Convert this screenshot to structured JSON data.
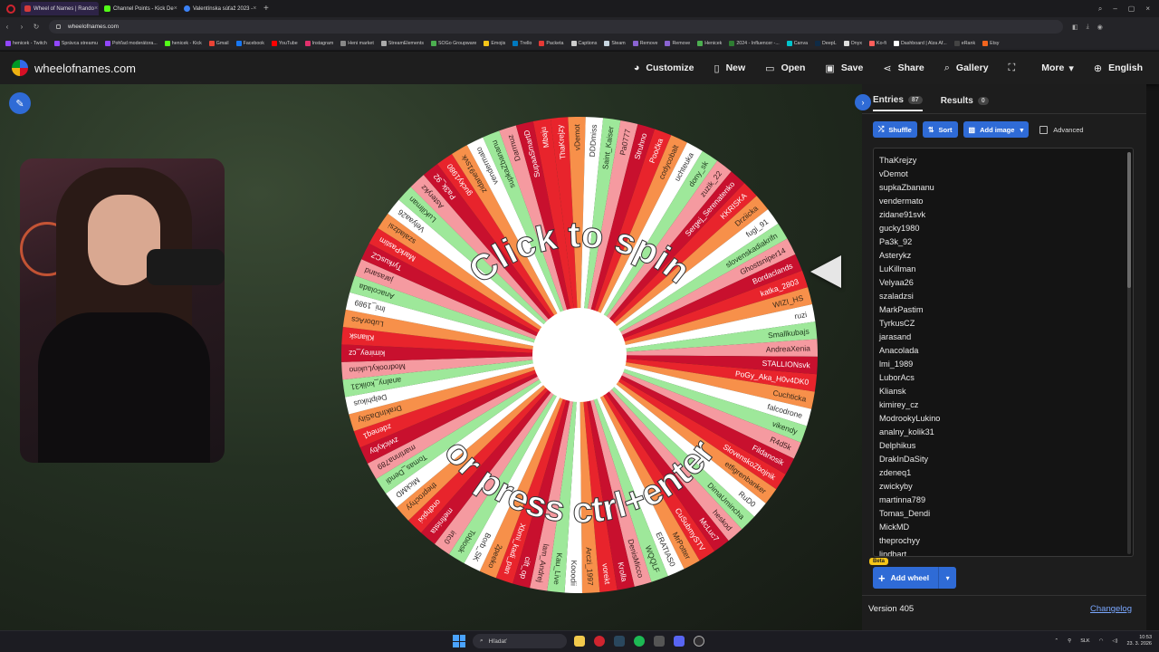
{
  "browser": {
    "tabs": [
      {
        "title": "Wheel of Names | Rando",
        "color": "#d43b3b",
        "active": true
      },
      {
        "title": "Channel Points - Kick De",
        "color": "#53fc18",
        "active": false
      },
      {
        "title": "Valentínska súťaž 2023 - ",
        "color": "#3b82f6",
        "active": false
      }
    ],
    "url": "wheelofnames.com",
    "bookmarks": [
      {
        "label": "henicek - Twitch",
        "color": "#9146ff"
      },
      {
        "label": "Správca streamu",
        "color": "#9146ff"
      },
      {
        "label": "Pohľad moderátora...",
        "color": "#9146ff"
      },
      {
        "label": "henicek - Kick",
        "color": "#53fc18"
      },
      {
        "label": "Gmail",
        "color": "#ea4335"
      },
      {
        "label": "Facebook",
        "color": "#1877f2"
      },
      {
        "label": "YouTube",
        "color": "#ff0000"
      },
      {
        "label": "Instagram",
        "color": "#e1306c"
      },
      {
        "label": "Heni market",
        "color": "#888888"
      },
      {
        "label": "StreamElements",
        "color": "#aaaaaa"
      },
      {
        "label": "SOGo Groupware",
        "color": "#4caf50"
      },
      {
        "label": "Emojis",
        "color": "#f5c518"
      },
      {
        "label": "Trello",
        "color": "#0079bf"
      },
      {
        "label": "Packeta",
        "color": "#e53935"
      },
      {
        "label": "Captions",
        "color": "#cccccc"
      },
      {
        "label": "Steam",
        "color": "#c7d5e0"
      },
      {
        "label": "Remove",
        "color": "#8a63d2"
      },
      {
        "label": "Remove",
        "color": "#8a63d2"
      },
      {
        "label": "Henicek",
        "color": "#4caf50"
      },
      {
        "label": "2024 - Influencer -...",
        "color": "#2e7d32"
      },
      {
        "label": "Canva",
        "color": "#00c4cc"
      },
      {
        "label": "DeepL",
        "color": "#0f2b46"
      },
      {
        "label": "Onyx",
        "color": "#dddddd"
      },
      {
        "label": "Ko-fi",
        "color": "#ff5e5b"
      },
      {
        "label": "Dashboard | Alza Af...",
        "color": "#ffffff"
      },
      {
        "label": "eRank",
        "color": "#444444"
      },
      {
        "label": "Etsy",
        "color": "#f1641e"
      }
    ]
  },
  "site": {
    "name": "wheelofnames.com",
    "menu": [
      {
        "label": "Customize",
        "icon": "palette-icon",
        "glyph": "◕"
      },
      {
        "label": "New",
        "icon": "new-file-icon",
        "glyph": "▯"
      },
      {
        "label": "Open",
        "icon": "folder-icon",
        "glyph": "▭"
      },
      {
        "label": "Save",
        "icon": "save-icon",
        "glyph": "▣"
      },
      {
        "label": "Share",
        "icon": "share-icon",
        "glyph": "⋖"
      },
      {
        "label": "Gallery",
        "icon": "search-icon",
        "glyph": "⌕"
      },
      {
        "label": "",
        "icon": "fullscreen-icon",
        "glyph": "⛶"
      },
      {
        "label": "More",
        "icon": "chevron-down-icon",
        "glyph": "▾"
      },
      {
        "label": "English",
        "icon": "globe-icon",
        "glyph": "⊕"
      }
    ]
  },
  "wheel": {
    "overlay_top": "Click to spin",
    "overlay_bottom": "or press ctrl+enter",
    "segment_colors": [
      "#e8242c",
      "#f7904a",
      "#ffffff",
      "#9ee89a",
      "#f59aa0",
      "#c8102e"
    ],
    "names": [
      "ThaKrejzy",
      "vDemot",
      "DDDmiss",
      "Saint_Kaiser",
      "Pa0777",
      "Struhno",
      "Poočka",
      "codycobalt",
      "uchteuka",
      "dony_sk",
      "zuzik_22",
      "Sergej_Serenatenko",
      "KKRISKA",
      "Drziicka",
      "fugi_91",
      "slovenskadiakrifn",
      "Ghostsniper14",
      "Bordaclands",
      "katka_2803",
      "WIZI_HS",
      "ruzi",
      "Smallkubajs",
      "AndreaXenia",
      "STALLIONsvk",
      "PoGy_Aka_H0v4DK0",
      "Cuchticka",
      "falcodrone",
      "vikendy",
      "R4d5k",
      "Fildanosik",
      "SlovenskoZbojnik",
      "etfigrenbanker",
      "RuD0",
      "DimaUmincha",
      "heskod",
      "McLuc7",
      "CuSubmySTV",
      "MrPotter",
      "ERATIAS0",
      "WQQLF",
      "DenisMicco",
      "Krolla",
      "vorekt",
      "Arczi_1997",
      "Kooodii",
      "Kau_Live",
      "lam_Andrej",
      "cift_op",
      "Xbmi_kadi_pan",
      "2peeko",
      "Borb_SK",
      "Tobiosk",
      "irtc0",
      "mefinista",
      "ondhpixi",
      "theprochyy",
      "MickMD",
      "Tomas_Dendi",
      "martinna789",
      "zwickyby",
      "zdeneq1",
      "DrakInDaSity",
      "Delphikus",
      "analny_kolik31",
      "ModrookyLukino",
      "kimirey_cz",
      "Kliansk",
      "LuborAcs",
      "lmi_1989",
      "Anacolada",
      "jarasand",
      "TyrkusCZ",
      "MarkPastim",
      "szaladzsi",
      "Velyaa26",
      "LuKillman",
      "Asterykz",
      "Pa3k_92",
      "gucky1980",
      "zidane91svk",
      "vendermato",
      "supkaZbananu",
      "Darrnuz",
      "SupaaSmartD",
      "Mbaju"
    ]
  },
  "sidebar": {
    "entries_tab": "Entries",
    "entries_count": "87",
    "results_tab": "Results",
    "results_count": "0",
    "shuffle": "Shuffle",
    "sort": "Sort",
    "add_image": "Add image",
    "advanced": "Advanced",
    "entries": [
      "ThaKrejzy",
      "vDemot",
      "supkaZbananu",
      "vendermato",
      "zidane91svk",
      "gucky1980",
      "Pa3k_92",
      "Asterykz",
      "LuKillman",
      "Velyaa26",
      "szaladzsi",
      "MarkPastim",
      "TyrkusCZ",
      "jarasand",
      "Anacolada",
      "lmi_1989",
      "LuborAcs",
      "Kliansk",
      "kimirey_cz",
      "ModrookyLukino",
      "analny_kolik31",
      "Delphikus",
      "DrakInDaSity",
      "zdeneq1",
      "zwickyby",
      "martinna789",
      "Tomas_Dendi",
      "MickMD",
      "theprochyy",
      "lindbart"
    ],
    "add_wheel": "Add wheel",
    "beta": "Beta",
    "version": "Version 405",
    "changelog": "Changelog"
  },
  "taskbar": {
    "search": "Hľadať",
    "lang": "SLK",
    "time": "10:53",
    "date": "23. 3. 2026"
  }
}
